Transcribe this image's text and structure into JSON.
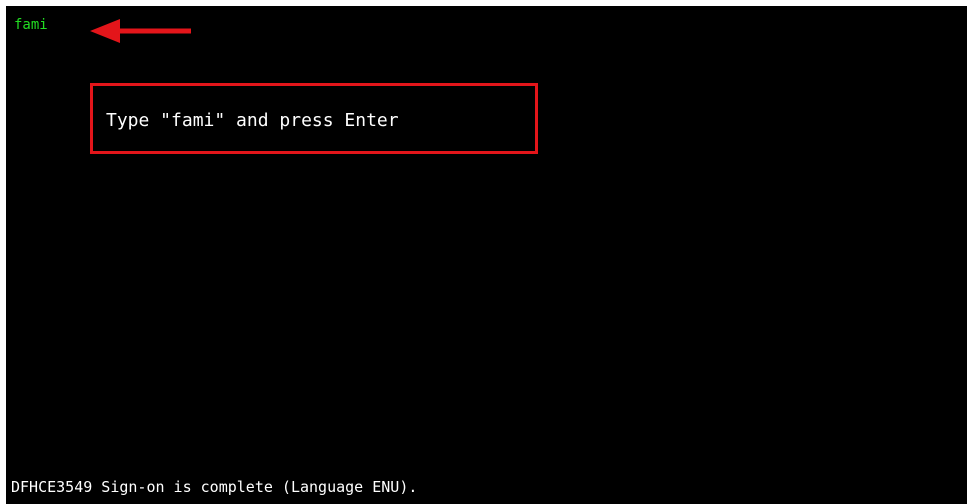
{
  "terminal": {
    "command_input": {
      "value": "fami"
    },
    "instruction_callout": {
      "text": "Type \"fami\" and press Enter"
    },
    "status_message": "DFHCE3549 Sign-on is complete (Language ENU)."
  },
  "colors": {
    "background": "#000000",
    "input_text": "#22dd22",
    "annotation": "#e3151a",
    "text": "#ffffff"
  },
  "icons": {
    "arrow": "arrow-left-icon"
  }
}
